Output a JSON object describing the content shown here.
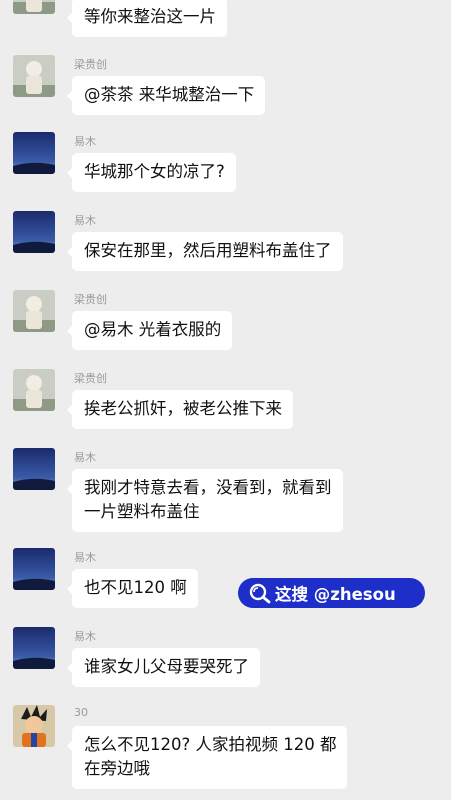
{
  "messages": [
    {
      "sender": "",
      "avatar": "baby-avatar",
      "lines": [
        "等你来整治这一片"
      ]
    },
    {
      "sender": "梁贵创",
      "avatar": "baby-avatar",
      "lines": [
        "@茶茶  来华城整治一下"
      ]
    },
    {
      "sender": "易木",
      "avatar": "sky-avatar",
      "lines": [
        "华城那个女的凉了?"
      ]
    },
    {
      "sender": "易木",
      "avatar": "sky-avatar",
      "lines": [
        "保安在那里，然后用塑料布盖住了"
      ]
    },
    {
      "sender": "梁贵创",
      "avatar": "baby-avatar",
      "lines": [
        "@易木  光着衣服的"
      ]
    },
    {
      "sender": "梁贵创",
      "avatar": "baby-avatar",
      "lines": [
        "挨老公抓奸，被老公推下来"
      ]
    },
    {
      "sender": "易木",
      "avatar": "sky-avatar",
      "lines": [
        "我刚才特意去看，没看到，就看到",
        "一片塑料布盖住"
      ]
    },
    {
      "sender": "易木",
      "avatar": "sky-avatar",
      "lines": [
        "也不见120 啊"
      ]
    },
    {
      "sender": "易木",
      "avatar": "sky-avatar",
      "lines": [
        "谁家女儿父母要哭死了"
      ]
    },
    {
      "sender": "30",
      "avatar": "cartoon-avatar",
      "lines": [
        "怎么不见120? 人家拍视频 120 都",
        "在旁边哦"
      ]
    }
  ],
  "watermark": {
    "text": "这搜 @zhesou",
    "icon": "search-icon",
    "color": "#1d2ec9"
  }
}
